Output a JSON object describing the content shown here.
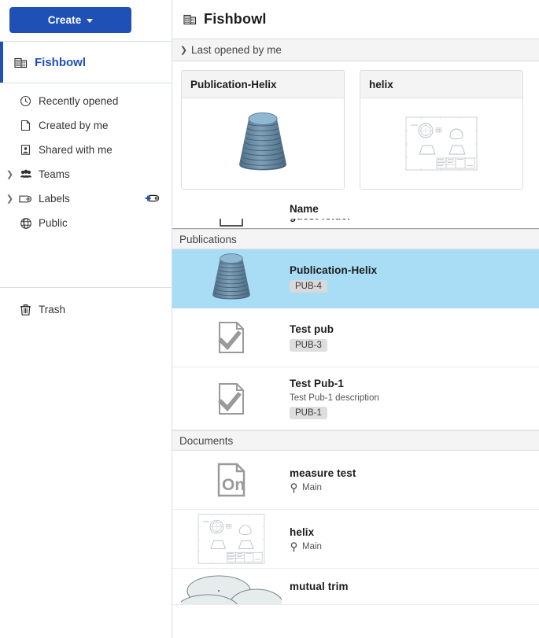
{
  "sidebar": {
    "create_button": {
      "label": "Create",
      "icon": "caret-down-icon"
    },
    "root": {
      "label": "Fishbowl",
      "icon": "company-building-icon"
    },
    "items": [
      {
        "label": "Recently opened",
        "icon": "clock-icon",
        "expandable": false
      },
      {
        "label": "Created by me",
        "icon": "document-icon",
        "expandable": false
      },
      {
        "label": "Shared with me",
        "icon": "shared-person-icon",
        "expandable": false
      },
      {
        "label": "Teams",
        "icon": "people-icon",
        "expandable": true
      },
      {
        "label": "Labels",
        "icon": "tag-icon",
        "expandable": true,
        "action_icon": "add-label-icon"
      },
      {
        "label": "Public",
        "icon": "globe-icon",
        "expandable": false
      }
    ],
    "trash": {
      "label": "Trash",
      "icon": "trash-icon"
    }
  },
  "header": {
    "title": "Fishbowl",
    "icon": "company-building-icon"
  },
  "recent_section": {
    "label": "Last opened by me",
    "expanded": true,
    "toggle_icon": "chevron-down-icon",
    "cards": [
      {
        "title": "Publication-Helix",
        "thumbnail": "cone-3d-model"
      },
      {
        "title": "helix",
        "thumbnail": "drawing-sheet"
      }
    ]
  },
  "list": {
    "columns": {
      "name": "Name"
    },
    "rows_top": [
      {
        "title": "guest folder",
        "icon": "folder-icon",
        "type": "folder"
      }
    ],
    "groups": [
      {
        "label": "Publications",
        "rows": [
          {
            "title": "Publication-Helix",
            "badge": "PUB-4",
            "thumbnail": "cone-3d-model",
            "selected": true
          },
          {
            "title": "Test pub",
            "badge": "PUB-3",
            "thumbnail": "publication-check-icon",
            "selected": false
          },
          {
            "title": "Test Pub-1",
            "description": "Test Pub-1 description",
            "badge": "PUB-1",
            "thumbnail": "publication-check-icon",
            "selected": false
          }
        ]
      },
      {
        "label": "Documents",
        "rows": [
          {
            "title": "measure test",
            "workspace": "Main",
            "workspace_icon": "branch-icon",
            "thumbnail": "onshape-doc-icon",
            "selected": false
          },
          {
            "title": "helix",
            "workspace": "Main",
            "workspace_icon": "branch-icon",
            "thumbnail": "drawing-sheet",
            "selected": false
          },
          {
            "title": "mutual trim",
            "thumbnail": "ellipses-model",
            "selected": false
          }
        ]
      }
    ]
  },
  "colors": {
    "accent": "#1e50b5",
    "selection": "#a9dcf5",
    "section_bg": "#f4f4f4",
    "badge_bg": "#dedede",
    "border": "#dcdcdc"
  }
}
